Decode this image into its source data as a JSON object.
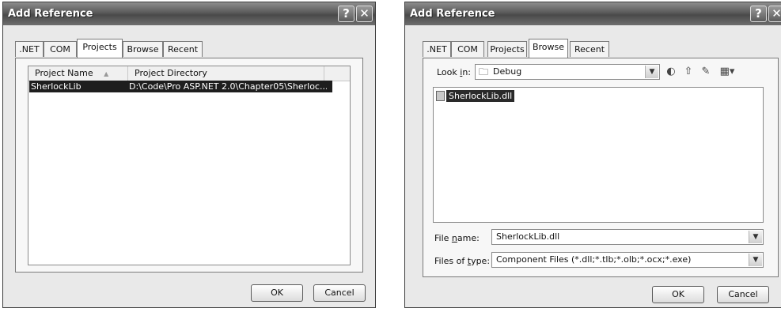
{
  "left_dialog": {
    "title": "Add Reference",
    "tabs": [
      ".NET",
      "COM",
      "Projects",
      "Browse",
      "Recent"
    ],
    "active_tab": "Projects",
    "columns": [
      "Project Name",
      "Project Directory"
    ],
    "rows": [
      {
        "name": "SherlockLib",
        "directory": "D:\\Code\\Pro ASP.NET 2.0\\Chapter05\\Sherloc..."
      }
    ],
    "ok_label": "OK",
    "cancel_label": "Cancel"
  },
  "right_dialog": {
    "title": "Add Reference",
    "tabs": [
      ".NET",
      "COM",
      "Projects",
      "Browse",
      "Recent"
    ],
    "active_tab": "Browse",
    "look_in_label_pre": "Look ",
    "look_in_label_u": "i",
    "look_in_label_post": "n:",
    "look_in_value": "Debug",
    "files": [
      "SherlockLib.dll"
    ],
    "file_name_label_pre": "File ",
    "file_name_label_u": "n",
    "file_name_label_post": "ame:",
    "file_name_value": "SherlockLib.dll",
    "files_of_type_label_pre": "Files of ",
    "files_of_type_label_u": "t",
    "files_of_type_label_post": "ype:",
    "files_of_type_value": "Component Files (*.dll;*.tlb;*.olb;*.ocx;*.exe)",
    "ok_label": "OK",
    "cancel_label": "Cancel"
  },
  "titlebar_buttons": {
    "help": "?",
    "close": "✕"
  },
  "icons": {
    "sort_arrow": "sort-ascending-icon",
    "folder": "folder-icon",
    "back": "back-icon",
    "up": "up-folder-icon",
    "new_folder": "new-folder-icon",
    "views": "views-menu-icon",
    "file": "dll-file-icon"
  }
}
